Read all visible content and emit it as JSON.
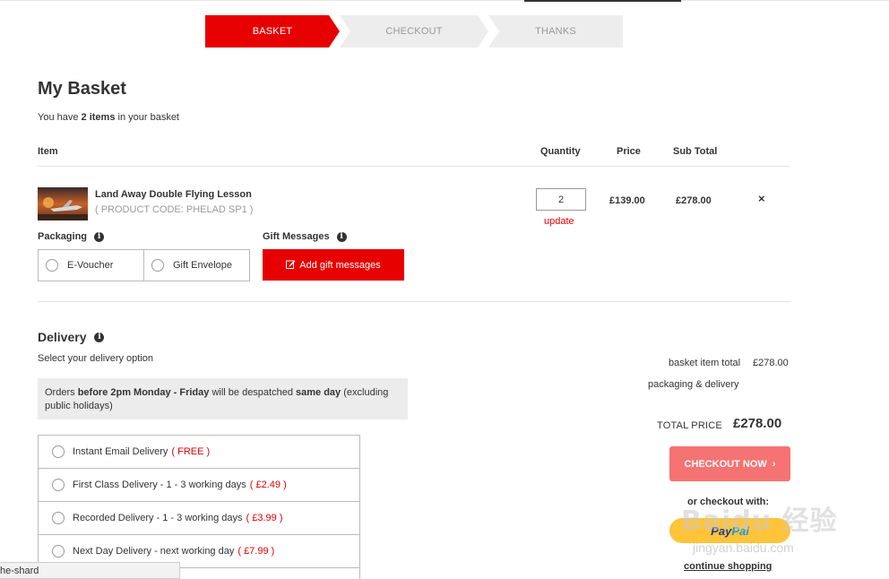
{
  "steps": [
    {
      "label": "BASKET",
      "active": true
    },
    {
      "label": "CHECKOUT",
      "active": false
    },
    {
      "label": "THANKS",
      "active": false
    }
  ],
  "page": {
    "title": "My Basket",
    "summary_prefix": "You have ",
    "summary_count": "2 items",
    "summary_suffix": " in your basket"
  },
  "table": {
    "headers": {
      "item": "Item",
      "quantity": "Quantity",
      "price": "Price",
      "subtotal": "Sub Total"
    }
  },
  "item": {
    "name": "Land Away Double Flying Lesson",
    "code": "( PRODUCT CODE: PHELAD SP1 )",
    "quantity": "2",
    "update_label": "update",
    "price": "£139.00",
    "subtotal": "£278.00",
    "remove_glyph": "×"
  },
  "packaging": {
    "label": "Packaging",
    "options": [
      "E-Voucher",
      "Gift Envelope"
    ]
  },
  "gift": {
    "label": "Gift Messages",
    "button_label": "Add gift messages"
  },
  "delivery": {
    "title": "Delivery",
    "subtitle": "Select your delivery option",
    "notice_prefix": "Orders ",
    "notice_bold1": "before 2pm Monday - Friday",
    "notice_mid": " will be despatched ",
    "notice_bold2": "same day",
    "notice_suffix": " (excluding public holidays)",
    "options": [
      {
        "label": "Instant Email Delivery ",
        "price": "( FREE )"
      },
      {
        "label": "First Class Delivery - 1 - 3 working days ",
        "price": "( £2.49 )"
      },
      {
        "label": "Recorded Delivery - 1 - 3 working days ",
        "price": "( £3.99 )"
      },
      {
        "label": "Next Day Delivery - next working day ",
        "price": "( £7.99 )"
      }
    ]
  },
  "totals": {
    "basket_label": "basket item total",
    "basket_value": "£278.00",
    "packaging_label": "packaging & delivery",
    "total_label": "TOTAL PRICE",
    "total_value": "£278.00",
    "checkout_label": "CHECKOUT NOW",
    "or_checkout": "or checkout with:",
    "paypal_a": "Pay",
    "paypal_b": "Pal",
    "continue": "continue shopping"
  },
  "watermark": {
    "text": "Baidu 经验",
    "sub": "jingyan.baidu.com"
  },
  "status_tip": "he-shard",
  "colors": {
    "accent": "#e60000",
    "checkout": "#f57372",
    "paypal": "#ffc43a",
    "step_inactive": "#ededee"
  }
}
